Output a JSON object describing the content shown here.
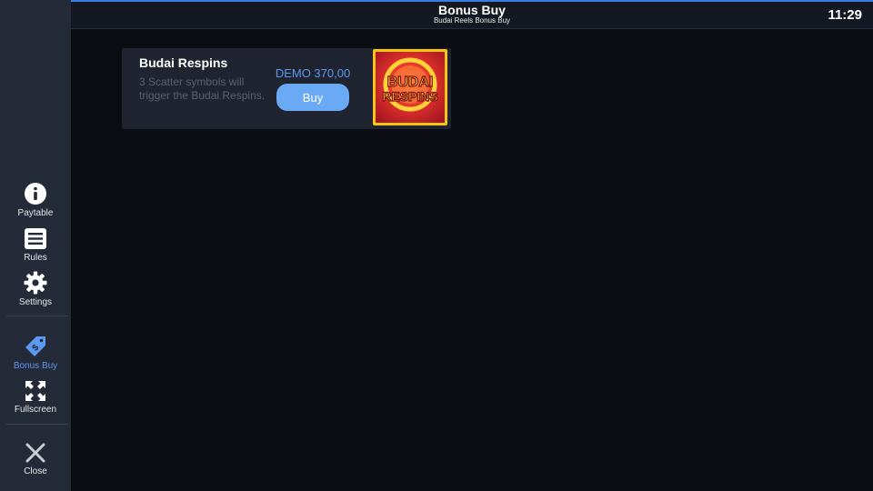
{
  "header": {
    "title": "Bonus Buy",
    "subtitle": "Budai Reels Bonus Buy",
    "clock": "11:29"
  },
  "sidebar": {
    "items": [
      {
        "label": "Paytable",
        "icon": "info-icon"
      },
      {
        "label": "Rules",
        "icon": "rules-list-icon"
      },
      {
        "label": "Settings",
        "icon": "gear-icon"
      },
      {
        "label": "Bonus Buy",
        "icon": "price-tag-icon",
        "active": true
      },
      {
        "label": "Fullscreen",
        "icon": "fullscreen-icon"
      },
      {
        "label": "Close",
        "icon": "close-icon"
      }
    ]
  },
  "bonus": {
    "title": "Budai Respins",
    "description": "3 Scatter symbols will trigger the Budai Respins.",
    "price": "DEMO 370,00",
    "buy_label": "Buy",
    "image_text_line1": "BUDAI",
    "image_text_line2": "RESPINS"
  },
  "colors": {
    "accent": "#5b9af0",
    "button": "#6aaaf5",
    "sidebar": "#242a38",
    "background": "#0b0d12",
    "card": "#1f2430",
    "thumb_border": "#f5c518"
  }
}
